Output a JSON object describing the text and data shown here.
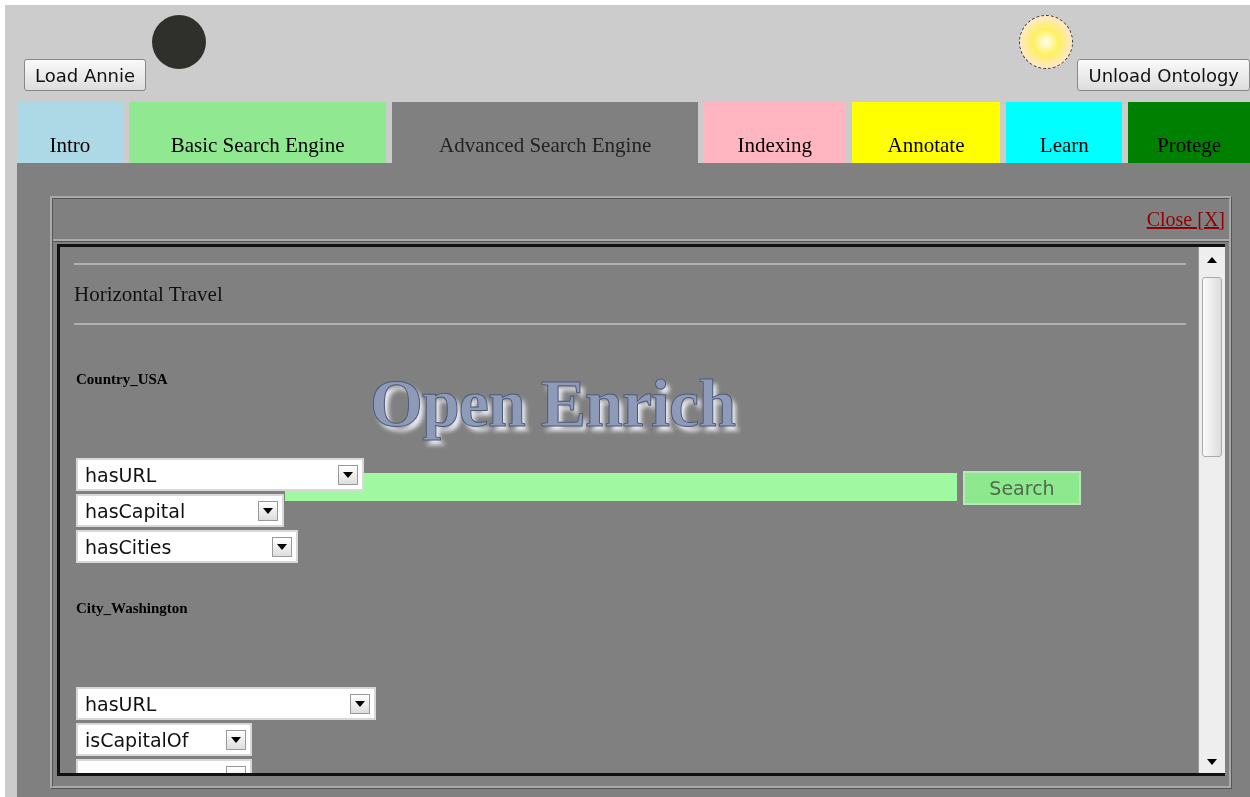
{
  "toolbar": {
    "load_button": "Load Annie",
    "annie_light": {
      "on": false
    },
    "ontology_light": {
      "on": true
    },
    "unload_button": "Unload Ontology"
  },
  "tabs": [
    {
      "label": "Intro",
      "color": "#add8e6",
      "selected": false
    },
    {
      "label": "Basic Search Engine",
      "color": "#90e890",
      "selected": false
    },
    {
      "label": "Advanced Search Engine",
      "color": "#808080",
      "selected": true
    },
    {
      "label": "Indexing",
      "color": "#ffb6c1",
      "selected": false
    },
    {
      "label": "Annotate",
      "color": "#ffff00",
      "selected": false
    },
    {
      "label": "Learn",
      "color": "#00ffff",
      "selected": false
    },
    {
      "label": "Protege",
      "color": "#008000",
      "selected": false
    }
  ],
  "dialog": {
    "close_link": "Close [X]",
    "heading": "Horizontal Travel",
    "logo": "Open Enrich",
    "search": {
      "button": "Search",
      "disabled": true
    },
    "sections": [
      {
        "title": "Country_USA",
        "properties": [
          {
            "value": "hasURL"
          },
          {
            "value": "hasCapital"
          },
          {
            "value": "hasCities"
          }
        ]
      },
      {
        "title": "City_Washington",
        "properties": [
          {
            "value": "hasURL"
          },
          {
            "value": "isCapitalOf"
          },
          {
            "kind": "partial"
          }
        ]
      }
    ]
  }
}
